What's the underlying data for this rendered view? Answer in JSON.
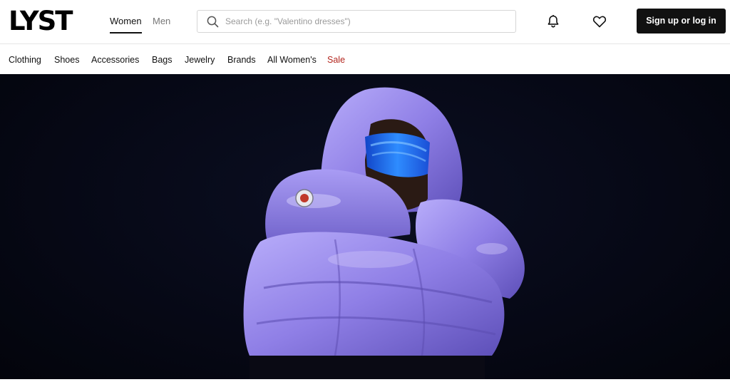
{
  "header": {
    "logo": "LYST",
    "gender_tabs": [
      {
        "label": "Women",
        "active": true
      },
      {
        "label": "Men",
        "active": false
      }
    ],
    "search": {
      "placeholder": "Search (e.g. \"Valentino dresses\")",
      "value": ""
    },
    "icons": [
      "search-icon",
      "bell-icon",
      "heart-icon"
    ],
    "signin_label": "Sign up or log in"
  },
  "categories": [
    {
      "label": "Clothing"
    },
    {
      "label": "Shoes"
    },
    {
      "label": "Accessories"
    },
    {
      "label": "Bags"
    },
    {
      "label": "Jewelry"
    },
    {
      "label": "Brands"
    },
    {
      "label": "All Women's"
    },
    {
      "label": "Sale"
    }
  ],
  "colors": {
    "accent": "#111111",
    "sale": "#b3261e",
    "hero_bg": "#060815",
    "jacket": "#8f7fe6",
    "goggles": "#1c6fff"
  }
}
